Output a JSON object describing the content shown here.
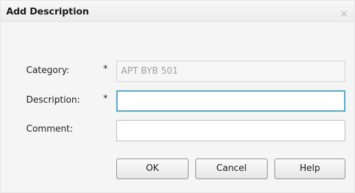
{
  "dialog": {
    "title": "Add Description",
    "close_icon": "close-icon"
  },
  "form": {
    "category": {
      "label": "Category:",
      "required_marker": "*",
      "value": "APT BYB 501"
    },
    "description": {
      "label": "Description:",
      "required_marker": "*",
      "value": ""
    },
    "comment": {
      "label": "Comment:",
      "value": ""
    }
  },
  "buttons": {
    "ok": "OK",
    "cancel": "Cancel",
    "help": "Help"
  },
  "colors": {
    "focus_border": "#58a9c2",
    "dialog_bg": "#f5f5f5"
  }
}
